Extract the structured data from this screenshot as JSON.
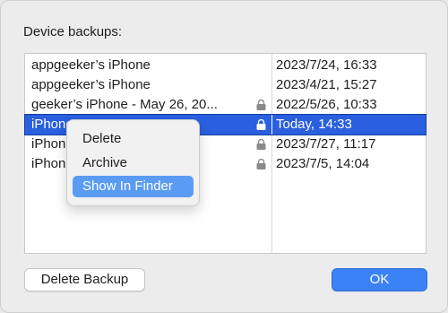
{
  "dialog": {
    "heading": "Device backups:"
  },
  "backups": [
    {
      "name": "appgeeker’s iPhone",
      "date": "2023/7/24, 16:33",
      "locked": false,
      "selected": false
    },
    {
      "name": "appgeeker’s iPhone",
      "date": "2023/4/21, 15:27",
      "locked": false,
      "selected": false
    },
    {
      "name": "geeker’s iPhone - May 26, 20...",
      "date": "2022/5/26, 10:33",
      "locked": true,
      "selected": false
    },
    {
      "name": "iPhone",
      "date": "Today, 14:33",
      "locked": true,
      "selected": true
    },
    {
      "name": "iPhon",
      "date": "2023/7/27, 11:17",
      "locked": true,
      "selected": false
    },
    {
      "name": "iPhon",
      "date": "2023/7/5, 14:04",
      "locked": true,
      "selected": false
    }
  ],
  "context_menu": {
    "items": [
      {
        "label": "Delete"
      },
      {
        "label": "Archive"
      },
      {
        "label": "Show In Finder",
        "highlighted": true
      }
    ]
  },
  "buttons": {
    "delete_backup": "Delete Backup",
    "ok": "OK"
  },
  "colors": {
    "selection": "#2a5fe0",
    "menu_highlight": "#5a9cf3",
    "primary_button": "#3b82f6"
  },
  "icons": {
    "lock": "lock-icon"
  }
}
